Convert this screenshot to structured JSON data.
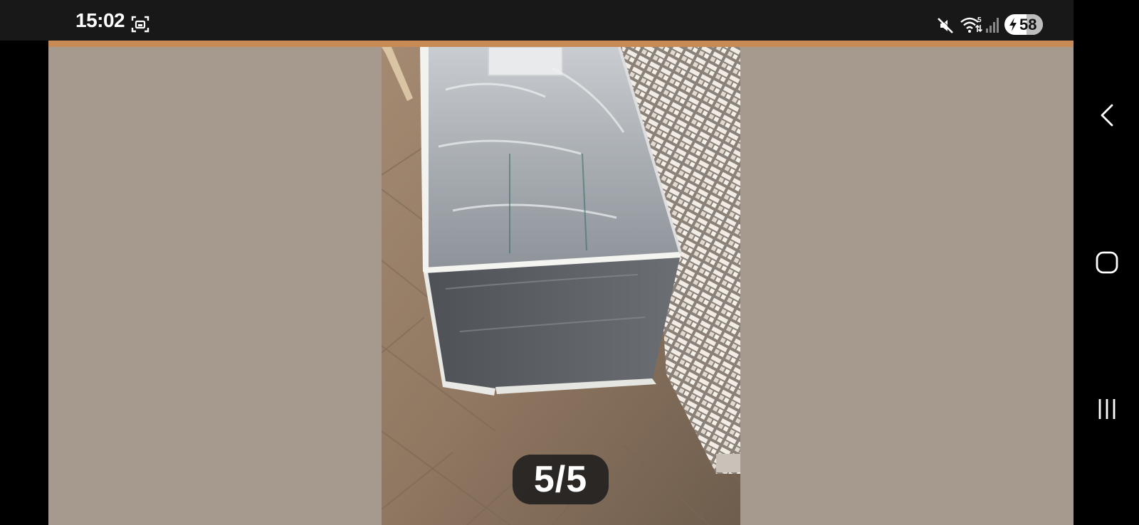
{
  "status_bar": {
    "time": "15:02",
    "icons": [
      "screenshot-icon",
      "mute-icon",
      "wifi-icon",
      "signal-icon",
      "battery-icon"
    ],
    "wifi_badge": "5",
    "battery_percent": "58",
    "battery_level": 0.58,
    "charging": true
  },
  "viewer": {
    "page_counter": "5/5",
    "accent_color": "#c98b55",
    "background_color": "#a59a8d"
  },
  "nav_bar": {
    "buttons": [
      "back-icon",
      "home-icon",
      "recents-icon"
    ]
  }
}
